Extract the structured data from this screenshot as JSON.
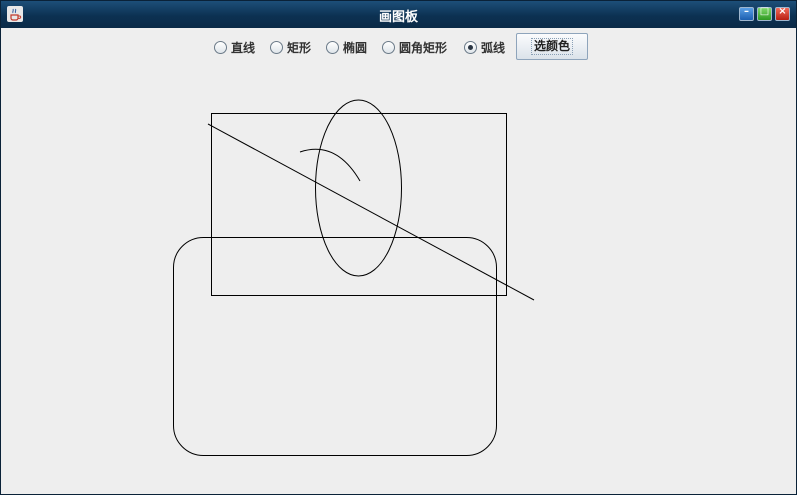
{
  "window": {
    "title": "画图板",
    "minimize_glyph": "–",
    "maximize_glyph": "□",
    "close_glyph": "×"
  },
  "toolbar": {
    "shapes": [
      {
        "label": "直线",
        "selected": false
      },
      {
        "label": "矩形",
        "selected": false
      },
      {
        "label": "椭圆",
        "selected": false
      },
      {
        "label": "圆角矩形",
        "selected": false
      },
      {
        "label": "弧线",
        "selected": true
      }
    ],
    "color_button_label": "选颜色"
  },
  "colors": {
    "titlebar": "#0c3152",
    "content_bg": "#eeeeee",
    "stroke": "#000000"
  }
}
